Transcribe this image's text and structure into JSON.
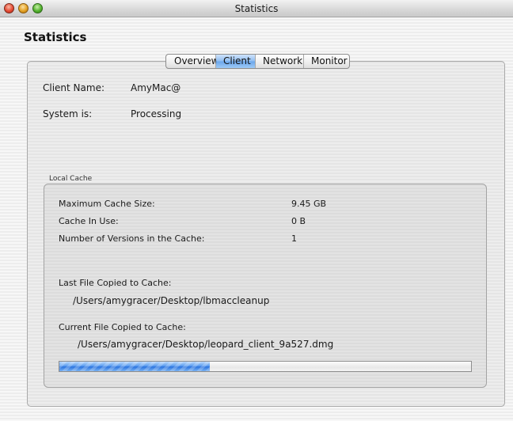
{
  "window": {
    "title": "Statistics"
  },
  "page": {
    "heading": "Statistics"
  },
  "tabs": [
    {
      "label": "Overview",
      "active": false
    },
    {
      "label": "Client",
      "active": true
    },
    {
      "label": "Network",
      "active": false
    },
    {
      "label": "Monitor",
      "active": false
    }
  ],
  "client": {
    "name_label": "Client Name:",
    "name_value": "AmyMac@",
    "status_label": "System is:",
    "status_value": "Processing"
  },
  "local_cache": {
    "section_label": "Local Cache",
    "max_size_label": "Maximum Cache Size:",
    "max_size_value": "9.45 GB",
    "in_use_label": "Cache In Use:",
    "in_use_value": "0 B",
    "versions_label": "Number of Versions in the Cache:",
    "versions_value": "1",
    "last_file_label": "Last File Copied to Cache:",
    "last_file_value": "/Users/amygracer/Desktop/lbmaccleanup",
    "current_file_label": "Current File Copied to Cache:",
    "current_file_value": "/Users/amygracer/Desktop/leopard_client_9a527.dmg",
    "progress_fraction": 0.365
  },
  "colors": {
    "active_tab": "#8dbcf1",
    "progress_fill": "#2b73de"
  },
  "icons": {
    "close": "close-icon",
    "minimize": "minimize-icon",
    "zoom": "zoom-icon"
  }
}
